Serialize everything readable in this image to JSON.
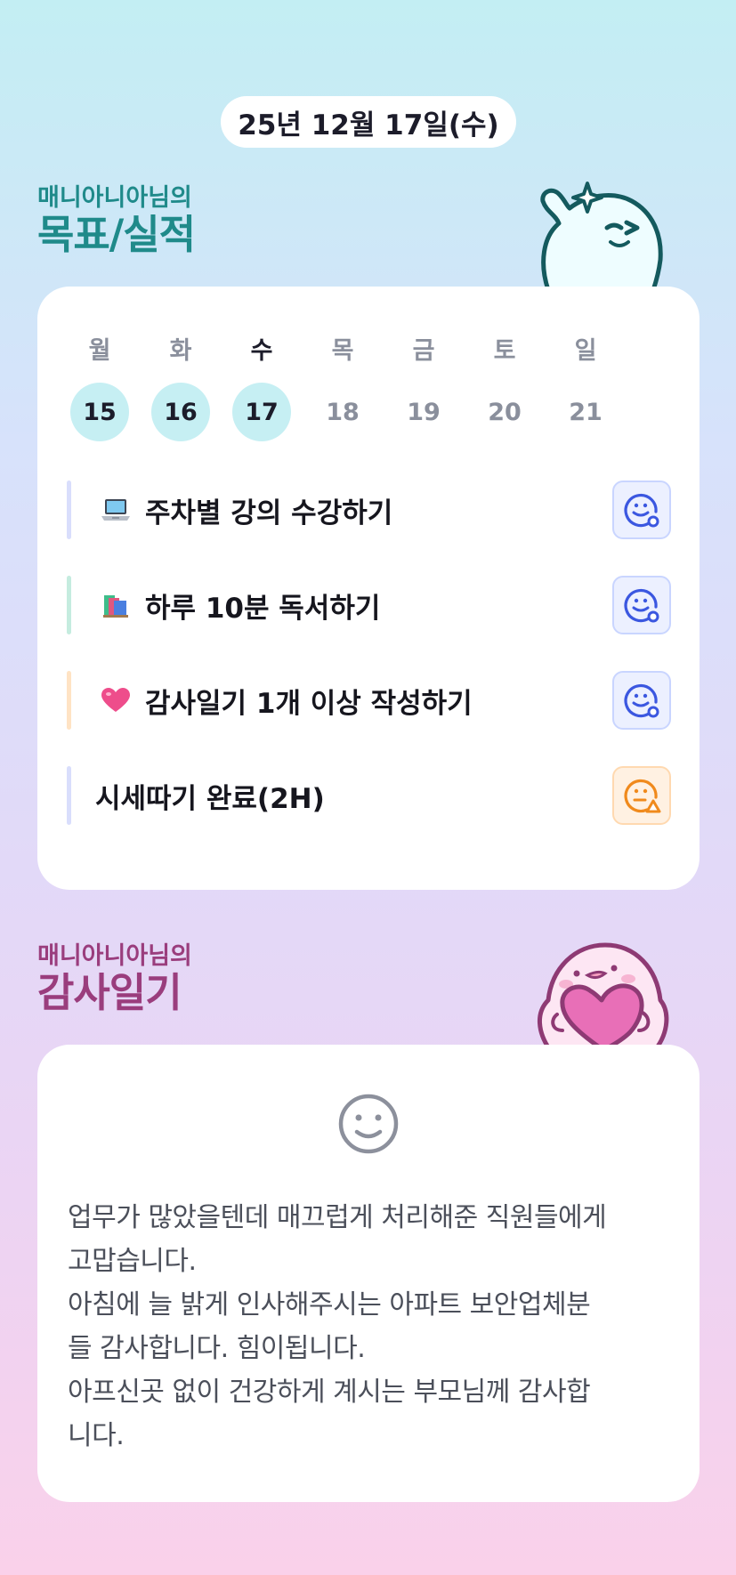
{
  "header": {
    "date": "25년 12월 17일(수)"
  },
  "goals_section": {
    "subtitle": "매니아니아님의",
    "title": "목표/실적"
  },
  "week": {
    "days": [
      "월",
      "화",
      "수",
      "목",
      "금",
      "토",
      "일"
    ],
    "dates": [
      "15",
      "16",
      "17",
      "18",
      "19",
      "20",
      "21"
    ],
    "today_index": 2,
    "completed_indices": [
      0,
      1,
      2
    ]
  },
  "goals": [
    {
      "emoji": "laptop-icon",
      "text": "주차별 강의 수강하기",
      "bar_color": "#d9defc",
      "status": "smile-blue-icon"
    },
    {
      "emoji": "books-icon",
      "text": "하루 10분 독서하기",
      "bar_color": "#c5ecdf",
      "status": "smile-blue-icon"
    },
    {
      "emoji": "heart-icon",
      "text": "감사일기 1개 이상 작성하기",
      "bar_color": "#ffe3c4",
      "status": "smile-blue-icon"
    },
    {
      "emoji": "",
      "text": "시세따기 완료(2H)",
      "bar_color": "#d9defc",
      "status": "neutral-orange-icon"
    }
  ],
  "thanks_section": {
    "subtitle": "매니아니아님의",
    "title": "감사일기",
    "mood_icon": "smile-face-icon",
    "text": "업무가 많았을텐데 매끄럽게 처리해준 직원들에게\n고맙습니다.\n아침에 늘 밝게 인사해주시는 아파트 보안업체분\n들 감사합니다. 힘이됩니다.\n아프신곳 없이 건강하게 계시는 부모님께 감사합\n니다."
  }
}
